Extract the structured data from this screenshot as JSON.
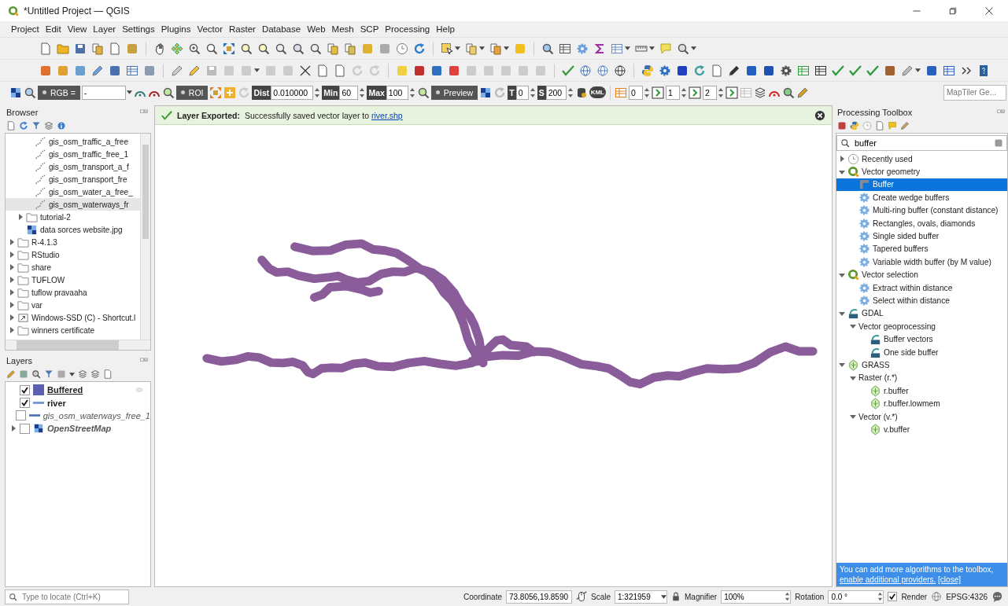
{
  "window": {
    "title": "*Untitled Project — QGIS"
  },
  "menu": [
    "Project",
    "Edit",
    "View",
    "Layer",
    "Settings",
    "Plugins",
    "Vector",
    "Raster",
    "Database",
    "Web",
    "Mesh",
    "SCP",
    "Processing",
    "Help"
  ],
  "scp_toolbar": {
    "band_set_label": "RGB =",
    "band_set_value": "-",
    "roi_button": "ROI",
    "dist_label": "Dist",
    "dist_value": "0.010000",
    "min_label": "Min",
    "min_value": "60",
    "max_label": "Max",
    "max_value": "100",
    "preview_button": "Preview",
    "t_label": "T",
    "t_value": "0",
    "s_label": "S",
    "s_value": "200",
    "kml_label": "KML",
    "band_values": [
      "0",
      "1",
      "2"
    ]
  },
  "locator_bar": {
    "placeholder": "MapTiler Ge..."
  },
  "browser": {
    "title": "Browser",
    "items": [
      {
        "children": [
          {
            "children": [
              {
                "label": "gis_osm_traffic_a_free",
                "kind": "vector-file",
                "selected": false
              },
              {
                "label": "gis_osm_traffic_free_1",
                "kind": "vector-file",
                "selected": false
              },
              {
                "label": "gis_osm_transport_a_f",
                "kind": "vector-file",
                "selected": false
              },
              {
                "label": "gis_osm_transport_fre",
                "kind": "vector-file",
                "selected": false
              },
              {
                "label": "gis_osm_water_a_free_",
                "kind": "vector-file",
                "selected": false
              },
              {
                "label": "gis_osm_waterways_fr",
                "kind": "vector-file",
                "selected": true
              }
            ]
          },
          {
            "label": "tutorial-2",
            "kind": "folder",
            "expanded": false,
            "selected": false
          },
          {
            "label": "data sorces website.jpg",
            "kind": "image",
            "selected": false
          }
        ]
      },
      {
        "label": "R-4.1.3",
        "kind": "folder",
        "expanded": false,
        "selected": false
      },
      {
        "label": "RStudio",
        "kind": "folder",
        "expanded": false,
        "selected": false
      },
      {
        "label": "share",
        "kind": "folder",
        "expanded": false,
        "selected": false
      },
      {
        "label": "TUFLOW",
        "kind": "folder",
        "expanded": false,
        "selected": false
      },
      {
        "label": "tuflow pravaaha",
        "kind": "folder",
        "expanded": false,
        "selected": false
      },
      {
        "label": "var",
        "kind": "folder",
        "expanded": false,
        "selected": false
      },
      {
        "label": "Windows-SSD (C) - Shortcut.l",
        "kind": "shortcut",
        "expanded": false,
        "selected": false
      },
      {
        "label": "winners certificate",
        "kind": "folder",
        "expanded": false,
        "selected": false
      }
    ]
  },
  "layers": {
    "title": "Layers",
    "items": [
      {
        "name": "Buffered",
        "kind": "polygon",
        "checked": true,
        "active": true,
        "color": "#5b5fb0"
      },
      {
        "name": "river",
        "kind": "line",
        "checked": true,
        "active": false,
        "color": "#6b8fd0"
      },
      {
        "name": "gis_osm_waterways_free_1",
        "kind": "line",
        "checked": false,
        "active": false,
        "color": "#4a6fb0"
      },
      {
        "name": "OpenStreetMap",
        "kind": "raster",
        "checked": false,
        "active": false,
        "expanded": false
      }
    ]
  },
  "message_bar": {
    "title": "Layer Exported:",
    "text": "Successfully saved vector layer to",
    "link": "river.shp"
  },
  "processing_toolbox": {
    "title": "Processing Toolbox",
    "search": {
      "value": "buffer"
    },
    "items": [
      {
        "label": "Recently used",
        "kind": "history",
        "expanded": false,
        "selected": false
      },
      {
        "label": "Vector geometry",
        "kind": "qgis",
        "expanded": true,
        "selected": false,
        "children": [
          {
            "label": "Buffer",
            "kind": "tool",
            "selected": true
          },
          {
            "label": "Create wedge buffers",
            "kind": "algorithm",
            "selected": false
          },
          {
            "label": "Multi-ring buffer (constant distance)",
            "kind": "algorithm",
            "selected": false
          },
          {
            "label": "Rectangles, ovals, diamonds",
            "kind": "algorithm",
            "selected": false
          },
          {
            "label": "Single sided buffer",
            "kind": "algorithm",
            "selected": false
          },
          {
            "label": "Tapered buffers",
            "kind": "algorithm",
            "selected": false
          },
          {
            "label": "Variable width buffer (by M value)",
            "kind": "algorithm",
            "selected": false
          }
        ]
      },
      {
        "label": "Vector selection",
        "kind": "qgis",
        "expanded": true,
        "selected": false,
        "children": [
          {
            "label": "Extract within distance",
            "kind": "algorithm",
            "selected": false
          },
          {
            "label": "Select within distance",
            "kind": "algorithm",
            "selected": false
          }
        ]
      },
      {
        "label": "GDAL",
        "kind": "gdal",
        "expanded": true,
        "selected": false,
        "children": [
          {
            "label": "Vector geoprocessing",
            "kind": "group",
            "expanded": true,
            "selected": false,
            "children": [
              {
                "label": "Buffer vectors",
                "kind": "gdal",
                "selected": false
              },
              {
                "label": "One side buffer",
                "kind": "gdal",
                "selected": false
              }
            ]
          }
        ]
      },
      {
        "label": "GRASS",
        "kind": "grass",
        "expanded": true,
        "selected": false,
        "children": [
          {
            "label": "Raster (r.*)",
            "kind": "group",
            "expanded": true,
            "selected": false,
            "children": [
              {
                "label": "r.buffer",
                "kind": "grass",
                "selected": false
              },
              {
                "label": "r.buffer.lowmem",
                "kind": "grass",
                "selected": false
              }
            ]
          },
          {
            "label": "Vector (v.*)",
            "kind": "group",
            "expanded": true,
            "selected": false,
            "children": [
              {
                "label": "v.buffer",
                "kind": "grass",
                "selected": false
              }
            ]
          }
        ]
      }
    ],
    "info": {
      "text": "You can add more algorithms to the toolbox,",
      "link": "enable additional providers.",
      "close_link": "[close]"
    }
  },
  "status_bar": {
    "locate_placeholder": "Type to locate (Ctrl+K)",
    "coordinate_label": "Coordinate",
    "coordinate": "73.8056,19.8590",
    "scale_label": "Scale",
    "scale": "1:321959",
    "magnifier_label": "Magnifier",
    "magnifier": "100%",
    "rotation_label": "Rotation",
    "rotation": "0.0 °",
    "render_checked": true,
    "render_label": "Render",
    "crs": "EPSG:4326"
  }
}
